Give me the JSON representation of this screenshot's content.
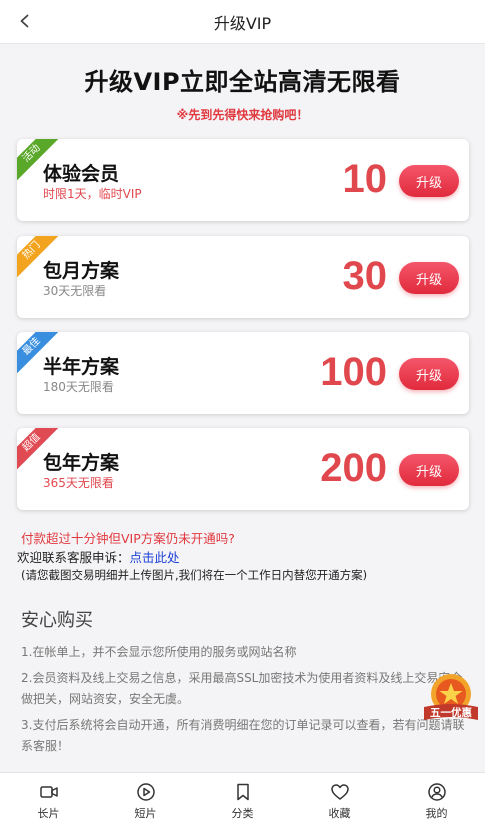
{
  "header": {
    "title": "升级VIP"
  },
  "main": {
    "title": "升级VIP立即全站高清无限看",
    "subtitle": "※先到先得快来抢购吧！"
  },
  "plans": [
    {
      "badge": "活动",
      "badge_color": "#5aa82a",
      "name": "体验会员",
      "desc": "时限1天，临时VIP",
      "desc_color": "#e0484e",
      "price": "10",
      "button": "升级"
    },
    {
      "badge": "热门",
      "badge_color": "#f2a41f",
      "name": "包月方案",
      "desc": "30天无限看",
      "desc_color": "#888888",
      "price": "30",
      "button": "升级"
    },
    {
      "badge": "最佳",
      "badge_color": "#3a8ee0",
      "name": "半年方案",
      "desc": "180天无限看",
      "desc_color": "#888888",
      "price": "100",
      "button": "升级"
    },
    {
      "badge": "超值",
      "badge_color": "#e04a52",
      "name": "包年方案",
      "desc": "365天无限看",
      "desc_color": "#e0484e",
      "price": "200",
      "button": "升级"
    }
  ],
  "notice": {
    "line1": "付款超过十分钟但VIP方案仍未开通吗?",
    "line2_prefix": "欢迎联系客服申诉：",
    "line2_link": "点击此处",
    "line3": "(请您截图交易明细并上传图片,我们将在一个工作日内替您开通方案)"
  },
  "safe": {
    "title": "安心购买",
    "items": [
      "1.在帐单上，并不会显示您所使用的服务或网站名称",
      "2.会员资料及线上交易之信息，采用最高SSL加密技术为使用者资料及线上交易安全做把关，网站资安，安全无虞。",
      "3.支付后系统将会自动开通，所有消费明细在您的订单记录可以查看，若有问题请联系客服！"
    ]
  },
  "float_badge": {
    "label": "五一优惠"
  },
  "tabs": [
    {
      "label": "长片",
      "icon": "video-camera-icon"
    },
    {
      "label": "短片",
      "icon": "play-circle-icon"
    },
    {
      "label": "分类",
      "icon": "bookmark-icon"
    },
    {
      "label": "收藏",
      "icon": "heart-icon"
    },
    {
      "label": "我的",
      "icon": "user-icon"
    }
  ]
}
